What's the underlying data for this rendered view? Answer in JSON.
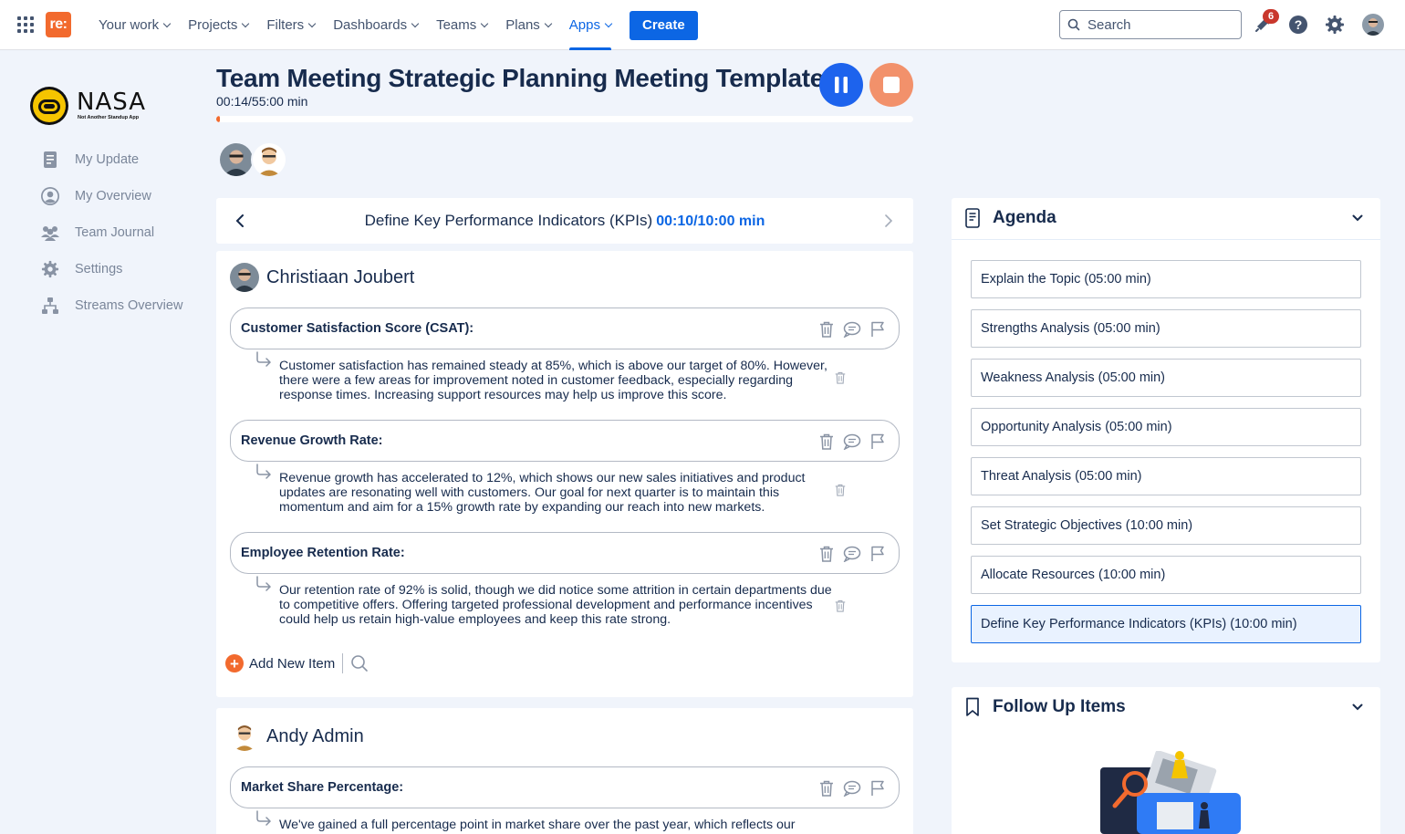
{
  "topnav": {
    "logo_text": "re:",
    "items": [
      {
        "label": "Your work"
      },
      {
        "label": "Projects"
      },
      {
        "label": "Filters"
      },
      {
        "label": "Dashboards"
      },
      {
        "label": "Teams"
      },
      {
        "label": "Plans"
      },
      {
        "label": "Apps",
        "active": true
      }
    ],
    "create_label": "Create",
    "search_placeholder": "Search",
    "notification_count": "6",
    "icons": [
      "app-grid-icon",
      "notification-icon",
      "help-icon",
      "settings-icon"
    ]
  },
  "sidebar": {
    "brand": "NASA",
    "brand_sub": "Not Another Standup App",
    "items": [
      {
        "label": "My Update",
        "icon": "document-icon"
      },
      {
        "label": "My Overview",
        "icon": "user-circle-icon"
      },
      {
        "label": "Team Journal",
        "icon": "people-icon"
      },
      {
        "label": "Settings",
        "icon": "gear-icon"
      },
      {
        "label": "Streams Overview",
        "icon": "hierarchy-icon"
      }
    ]
  },
  "meeting": {
    "title": "Team Meeting Strategic Planning Meeting Template",
    "time": "00:14/55:00 min",
    "progress_fraction": 0.004,
    "colors": {
      "pause": "#1d63ed",
      "stop": "#f2916b",
      "accent": "#f26a2e"
    }
  },
  "topic": {
    "title": "Define Key Performance Indicators (KPIs)",
    "time": "00:10/10:00 min"
  },
  "users": [
    {
      "name": "Christiaan Joubert",
      "items": [
        {
          "title": "Customer Satisfaction Score (CSAT):",
          "reply": "Customer satisfaction has remained steady at 85%, which is above our target of 80%. However, there were a few areas for improvement noted in customer feedback, especially regarding response times. Increasing support resources may help us improve this score."
        },
        {
          "title": "Revenue Growth Rate:",
          "reply": "Revenue growth has accelerated to 12%, which shows our new sales initiatives and product updates are resonating well with customers. Our goal for next quarter is to maintain this momentum and aim for a 15% growth rate by expanding our reach into new markets."
        },
        {
          "title": "Employee Retention Rate:",
          "reply": "Our retention rate of 92% is solid, though we did notice some attrition in certain departments due to competitive offers. Offering targeted professional development and performance incentives could help us retain high-value employees and keep this rate strong."
        }
      ],
      "add_label": "Add New Item"
    },
    {
      "name": "Andy Admin",
      "items": [
        {
          "title": "Market Share Percentage:",
          "reply": "We've gained a full percentage point in market share over the past year, which reflects our successful campaigns and new product launches. To sustain this growth, we may need to"
        }
      ]
    }
  ],
  "agenda": {
    "title": "Agenda",
    "items": [
      {
        "label": "Explain the Topic (05:00 min)"
      },
      {
        "label": "Strengths Analysis (05:00 min)"
      },
      {
        "label": "Weakness Analysis (05:00 min)"
      },
      {
        "label": "Opportunity Analysis (05:00 min)"
      },
      {
        "label": "Threat Analysis (05:00 min)"
      },
      {
        "label": "Set Strategic Objectives (10:00 min)"
      },
      {
        "label": "Allocate Resources (10:00 min)"
      },
      {
        "label": "Define Key Performance Indicators (KPIs) (10:00 min)",
        "current": true
      }
    ]
  },
  "follow_up": {
    "title": "Follow Up Items"
  }
}
